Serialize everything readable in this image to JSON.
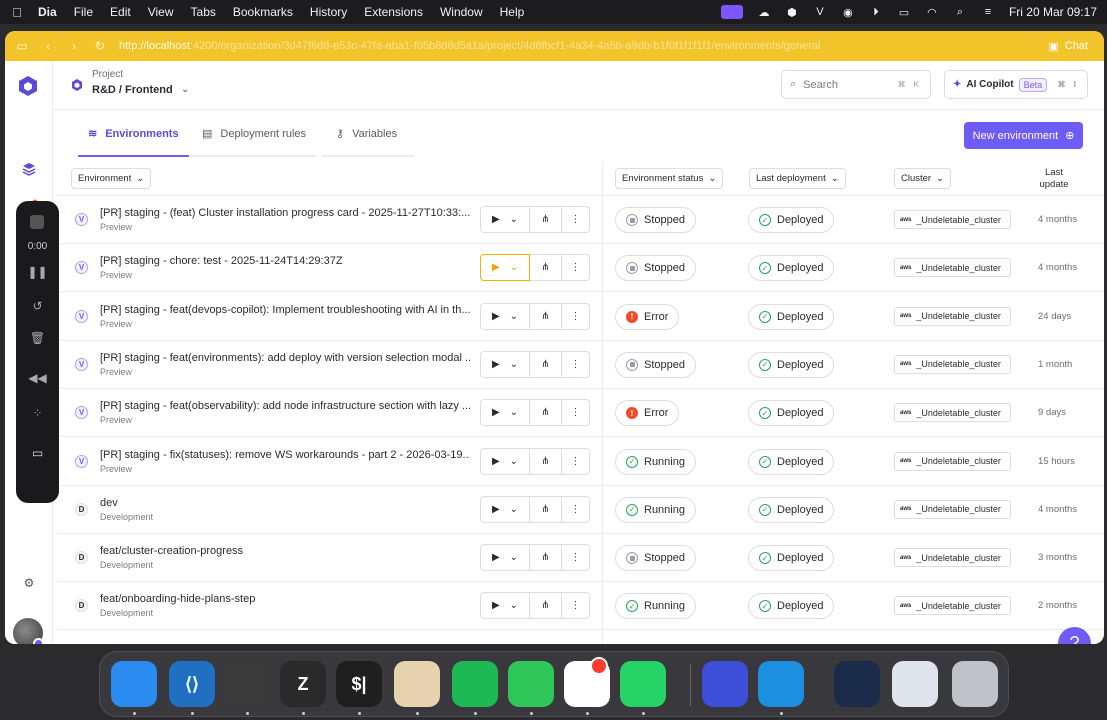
{
  "menubar": {
    "app": "Dia",
    "items": [
      "File",
      "Edit",
      "View",
      "Tabs",
      "Bookmarks",
      "History",
      "Extensions",
      "Window",
      "Help"
    ],
    "clock": "Fri 20 Mar  09:17"
  },
  "browser": {
    "url_visible": "http://localhost",
    "url_rest": ":4200/organization/3d47f6d8-e53c-47fa-aba1-f05b8d8d5a1a/project/4d8fbcf1-4a34-4a5b-a9db-b1f0f1f1f1f1/environments/general",
    "chat_label": "Chat"
  },
  "header": {
    "project_label": "Project",
    "project_name": "R&D / Frontend",
    "search_placeholder": "Search",
    "search_kbd": "⌘ K",
    "copilot_label": "AI Copilot",
    "copilot_badge": "Beta",
    "copilot_kbd": "⌘ I"
  },
  "tabs": [
    {
      "label": "Environments",
      "active": true
    },
    {
      "label": "Deployment rules",
      "active": false
    },
    {
      "label": "Variables",
      "active": false
    }
  ],
  "new_env_label": "New environment",
  "table": {
    "headers": {
      "environment": "Environment",
      "status": "Environment status",
      "last_deployment": "Last deployment",
      "cluster": "Cluster",
      "last_update_1": "Last",
      "last_update_2": "update"
    },
    "rows": [
      {
        "badge": "V",
        "title": "[PR] staging - (feat) Cluster installation progress card - 2025-11-27T10:33:...",
        "type": "Preview",
        "status": "Stopped",
        "deployment": "Deployed",
        "cluster": "_Undeletable_cluster",
        "updated": "4 months",
        "highlight": false
      },
      {
        "badge": "V",
        "title": "[PR] staging - chore: test - 2025-11-24T14:29:37Z",
        "type": "Preview",
        "status": "Stopped",
        "deployment": "Deployed",
        "cluster": "_Undeletable_cluster",
        "updated": "4 months",
        "highlight": true
      },
      {
        "badge": "V",
        "title": "[PR] staging - feat(devops-copilot): Implement troubleshooting with AI in th...",
        "type": "Preview",
        "status": "Error",
        "deployment": "Deployed",
        "cluster": "_Undeletable_cluster",
        "updated": "24 days",
        "highlight": false
      },
      {
        "badge": "V",
        "title": "[PR] staging - feat(environments): add deploy with version selection modal ...",
        "type": "Preview",
        "status": "Stopped",
        "deployment": "Deployed",
        "cluster": "_Undeletable_cluster",
        "updated": "1 month",
        "highlight": false
      },
      {
        "badge": "V",
        "title": "[PR] staging - feat(observability): add node infrastructure section with lazy ...",
        "type": "Preview",
        "status": "Error",
        "deployment": "Deployed",
        "cluster": "_Undeletable_cluster",
        "updated": "9 days",
        "highlight": false
      },
      {
        "badge": "V",
        "title": "[PR] staging - fix(statuses): remove WS workarounds - part 2 - 2026-03-19...",
        "type": "Preview",
        "status": "Running",
        "deployment": "Deployed",
        "cluster": "_Undeletable_cluster",
        "updated": "15 hours",
        "highlight": false
      },
      {
        "badge": "D",
        "title": "dev",
        "type": "Development",
        "status": "Running",
        "deployment": "Deployed",
        "cluster": "_Undeletable_cluster",
        "updated": "4 months",
        "highlight": false
      },
      {
        "badge": "D",
        "title": "feat/cluster-creation-progress",
        "type": "Development",
        "status": "Stopped",
        "deployment": "Deployed",
        "cluster": "_Undeletable_cluster",
        "updated": "3 months",
        "highlight": false
      },
      {
        "badge": "D",
        "title": "feat/onboarding-hide-plans-step",
        "type": "Development",
        "status": "Running",
        "deployment": "Deployed",
        "cluster": "_Undeletable_cluster",
        "updated": "2 months",
        "highlight": false
      }
    ]
  },
  "recorder": {
    "time": "0:00"
  },
  "dock": [
    {
      "name": "finder",
      "color": "#2a8cf0",
      "glyph": ""
    },
    {
      "name": "vscode",
      "color": "#1f6fc2",
      "glyph": "⟨⟩"
    },
    {
      "name": "cube-app",
      "color": "#3a3a3a",
      "glyph": ""
    },
    {
      "name": "zed",
      "color": "#2a2a2a",
      "glyph": "Z"
    },
    {
      "name": "terminal",
      "color": "#1f1f1f",
      "glyph": "$|"
    },
    {
      "name": "arc",
      "color": "#e8d3b0",
      "glyph": ""
    },
    {
      "name": "spotify",
      "color": "#1db954",
      "glyph": ""
    },
    {
      "name": "facetime",
      "color": "#2fc75a",
      "glyph": ""
    },
    {
      "name": "slack",
      "color": "#ffffff",
      "glyph": ""
    },
    {
      "name": "whatsapp",
      "color": "#25d366",
      "glyph": ""
    },
    {
      "name": "dia-app",
      "color": "#3d4fd8",
      "glyph": ""
    },
    {
      "name": "docker",
      "color": "#1d8fe0",
      "glyph": ""
    },
    {
      "name": "window-preview",
      "color": "#1b2b4a",
      "glyph": ""
    },
    {
      "name": "window-preview-2",
      "color": "#dfe4ea",
      "glyph": ""
    },
    {
      "name": "trash",
      "color": "#bfc2c7",
      "glyph": ""
    }
  ]
}
